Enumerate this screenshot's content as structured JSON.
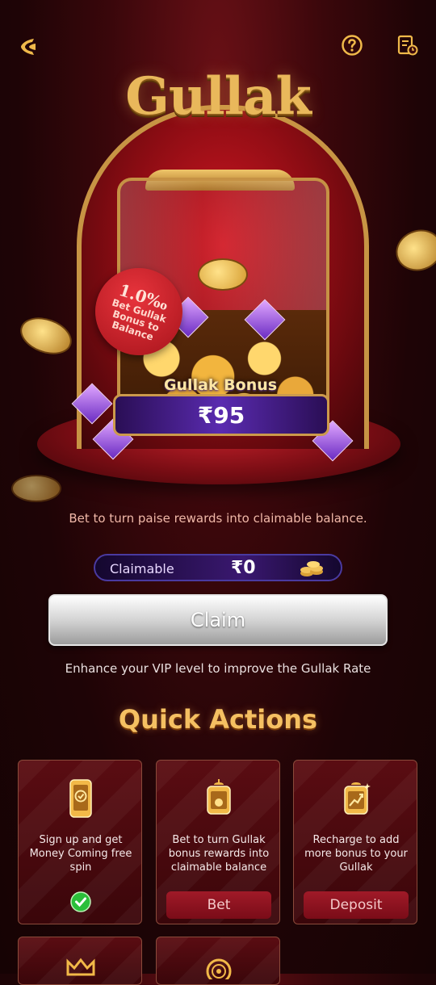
{
  "header": {
    "back_icon": "back-arrow-icon",
    "help_icon": "question-circle-icon",
    "history_icon": "records-icon"
  },
  "hero": {
    "logo_text": "Gullak",
    "rate_tag": {
      "rate": "1.0‰",
      "text": "Bet Gullak Bonus to Balance"
    },
    "bonus_label": "Gullak Bonus",
    "bonus_amount": "₹95"
  },
  "subtitle": "Bet to turn paise rewards into claimable balance.",
  "claimable": {
    "label": "Claimable",
    "value": "₹0",
    "icon": "coin-stack-icon"
  },
  "claim_button": "Claim",
  "vip_note": "Enhance your VIP level to improve the Gullak Rate",
  "quick_actions": {
    "title": "Quick Actions",
    "cards": [
      {
        "icon": "phone-check-icon",
        "text": "Sign up and get Money Coming free spin",
        "status": "done",
        "status_icon": "checkmark-circle-icon"
      },
      {
        "icon": "gullak-jar-icon",
        "text": "Bet to turn Gullak bonus rewards into claimable balance",
        "button": "Bet"
      },
      {
        "icon": "recharge-chart-icon",
        "text": "Recharge to add more bonus to your Gullak",
        "button": "Deposit"
      }
    ],
    "more_icons": [
      "crown-icon",
      "wheel-icon"
    ]
  },
  "colors": {
    "accent_gold": "#f5c062",
    "claim_button": "#c8c8c8",
    "card_button": "#8c1220",
    "check": "#2bbf3a"
  }
}
